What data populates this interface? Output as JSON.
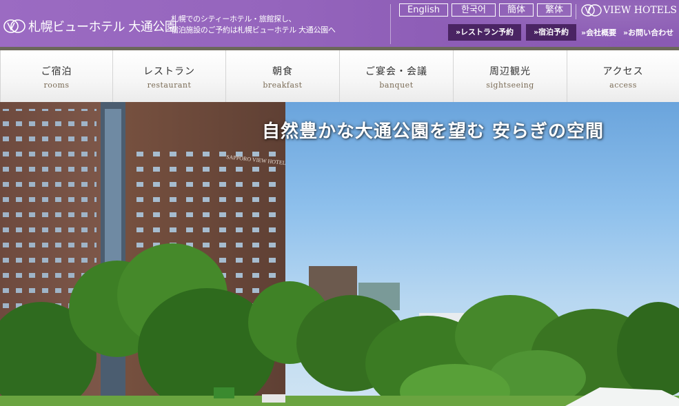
{
  "header": {
    "logo_text": "札幌ビューホテル 大通公園",
    "tagline_line1": "札幌でのシティーホテル・旅館探し、",
    "tagline_line2": "宿泊施設のご予約は札幌ビューホテル 大通公園へ",
    "languages": [
      "English",
      "한국어",
      "簡体",
      "繁体"
    ],
    "restaurant_button": "»レストラン予約",
    "stay_button": "»宿泊予約",
    "company_link": "»会社概要",
    "contact_link": "»お問い合わせ",
    "brand_text": "VIEW HOTELS",
    "colors": {
      "header_purple": "#9565bd",
      "button_dark": "#4a2463"
    }
  },
  "nav": [
    {
      "jp": "ご宿泊",
      "en": "rooms"
    },
    {
      "jp": "レストラン",
      "en": "restaurant"
    },
    {
      "jp": "朝食",
      "en": "breakfast"
    },
    {
      "jp": "ご宴会・会議",
      "en": "banquet"
    },
    {
      "jp": "周辺観光",
      "en": "sightseeing"
    },
    {
      "jp": "アクセス",
      "en": "access"
    }
  ],
  "hero": {
    "caption": "自然豊かな大通公園を望む 安らぎの空間",
    "building_sign": "SAPPORO VIEW HOTEL"
  }
}
